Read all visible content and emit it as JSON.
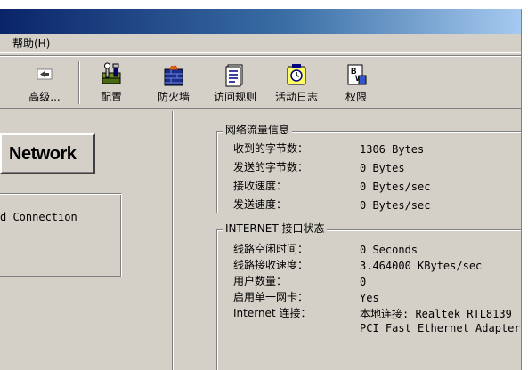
{
  "menu": {
    "help": "帮助(H)"
  },
  "toolbar": {
    "items": [
      {
        "label": "高级...",
        "icon": "back-arrow-icon"
      },
      {
        "label": "配置",
        "icon": "config-tools-icon"
      },
      {
        "label": "防火墙",
        "icon": "firewall-icon"
      },
      {
        "label": "访问规则",
        "icon": "rules-document-icon"
      },
      {
        "label": "活动日志",
        "icon": "log-icon"
      },
      {
        "label": "权限",
        "icon": "permissions-icon"
      }
    ]
  },
  "left": {
    "network_button": "Network",
    "connection_text": "d Connection"
  },
  "traffic": {
    "title": "网络流量信息",
    "rows": [
      {
        "label": "收到的字节数：",
        "value": "1306 Bytes"
      },
      {
        "label": "发送的字节数：",
        "value": "0 Bytes"
      },
      {
        "label": "接收速度：",
        "value": "0 Bytes/sec"
      },
      {
        "label": "发送速度：",
        "value": "0 Bytes/sec"
      }
    ]
  },
  "internet": {
    "title": "INTERNET 接口状态",
    "rows": [
      {
        "label": "线路空闲时间：",
        "value": "0 Seconds"
      },
      {
        "label": "线路接收速度：",
        "value": "3.464000 KBytes/sec"
      },
      {
        "label": "用户数量：",
        "value": "0"
      },
      {
        "label": "启用单一网卡：",
        "value": "Yes"
      },
      {
        "label": "Internet 连接：",
        "value": "本地连接: Realtek RTL8139"
      }
    ],
    "continuation": "PCI Fast Ethernet Adapter"
  },
  "colors": {
    "face": "#d4d0c8",
    "shadow": "#808080",
    "highlight": "#ffffff",
    "title_start": "#0a246a",
    "title_end": "#a6caf0"
  }
}
